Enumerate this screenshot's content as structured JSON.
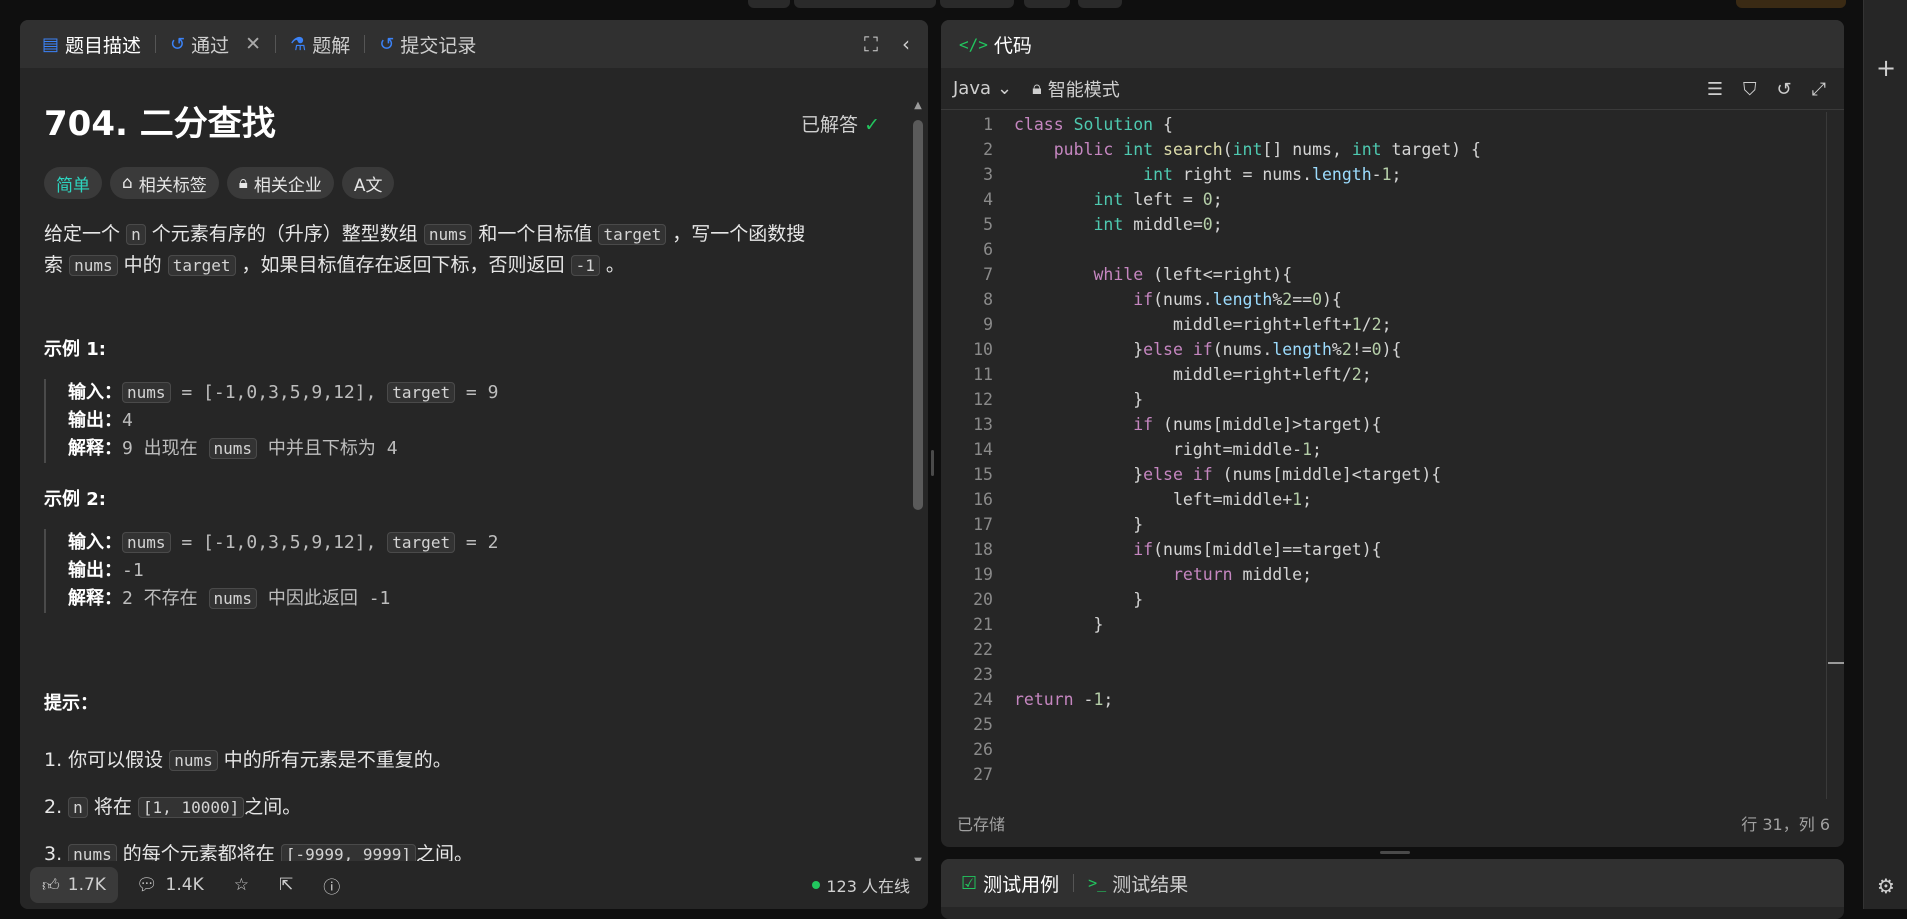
{
  "left_tabs": [
    {
      "label": "题目描述",
      "icon": "doc-icon"
    },
    {
      "label": "通过",
      "icon": "history-icon"
    },
    {
      "label": "题解",
      "icon": "flask-icon"
    },
    {
      "label": "提交记录",
      "icon": "history-icon"
    }
  ],
  "problem": {
    "title": "704. 二分查找",
    "solved": "已解答",
    "tags": {
      "difficulty": "简单",
      "related_tags": "相关标签",
      "related_companies": "相关企业",
      "translate": "A文"
    },
    "desc_p1": "给定一个",
    "desc_c1": "n",
    "desc_p2": "个元素有序的（升序）整型数组",
    "desc_c2": "nums",
    "desc_p3": "和一个目标值",
    "desc_c3": "target",
    "desc_p4": "，写一个函数搜索",
    "desc_c4": "nums",
    "desc_p5": "中的",
    "desc_c5": "target",
    "desc_p6": "，如果目标值存在返回下标，否则返回",
    "desc_c6": "-1",
    "desc_p7": "。"
  },
  "example1": {
    "heading": "示例 1:",
    "input_label": "输入：",
    "nums_code": "nums",
    "input_mid": " = [-1,0,3,5,9,12], ",
    "target_code": "target",
    "input_end": " = 9",
    "output_label": "输出：",
    "output_value": "4",
    "explain_label": "解释：",
    "explain_a": "9 出现在 ",
    "explain_code": "nums",
    "explain_b": " 中并且下标为 4"
  },
  "example2": {
    "heading": "示例 2:",
    "input_label": "输入：",
    "nums_code": "nums",
    "input_mid": " = [-1,0,3,5,9,12], ",
    "target_code": "target",
    "input_end": " = 2",
    "output_label": "输出：",
    "output_value": "-1",
    "explain_label": "解释：",
    "explain_a": "2 不存在 ",
    "explain_code": "nums",
    "explain_b": " 中因此返回 -1"
  },
  "hints": {
    "heading": "提示：",
    "h1_a": "1. 你可以假设 ",
    "h1_code": "nums",
    "h1_b": " 中的所有元素是不重复的。",
    "h2_a": "2. ",
    "h2_code1": "n",
    "h2_b": " 将在 ",
    "h2_code2": "[1, 10000]",
    "h2_c": "之间。",
    "h3_a": "3. ",
    "h3_code1": "nums",
    "h3_b": " 的每个元素都将在 ",
    "h3_code2": "[-9999, 9999]",
    "h3_c": "之间。"
  },
  "footer": {
    "likes": "1.7K",
    "comments": "1.4K",
    "online": "123 人在线"
  },
  "code_panel": {
    "title": "代码",
    "language": "Java",
    "mode": "智能模式",
    "saved": "已存储",
    "cursor": "行 31，列 6"
  },
  "code_lines": [
    "class Solution {",
    "    public int search(int[] nums, int target) {",
    "             int right = nums.length-1;",
    "        int left = 0;",
    "        int middle=0;",
    "",
    "        while (left<=right){",
    "            if(nums.length%2==0){",
    "                middle=right+left+1/2;",
    "            }else if(nums.length%2!=0){",
    "                middle=right+left/2;",
    "            }",
    "            if (nums[middle]>target){",
    "                right=middle-1;",
    "            }else if (nums[middle]<target){",
    "                left=middle+1;",
    "            }",
    "            if(nums[middle]==target){",
    "                return middle;",
    "            }",
    "        }",
    "",
    "",
    "return -1;",
    "",
    "",
    ""
  ],
  "test_tabs": {
    "cases": "测试用例",
    "results": "测试结果"
  }
}
